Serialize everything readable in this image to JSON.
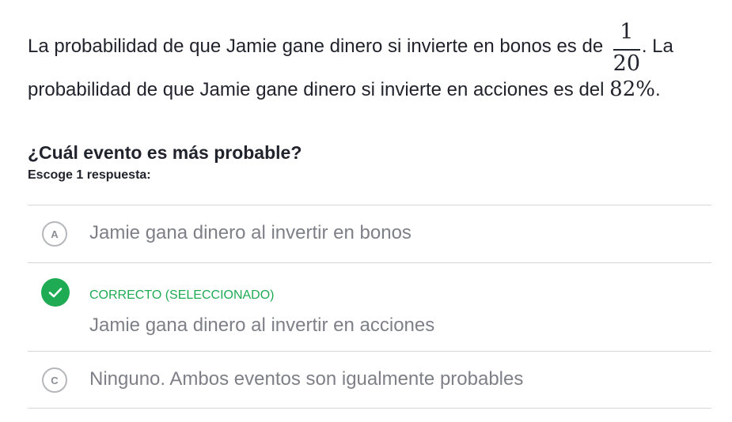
{
  "question": {
    "line1_text": "La probabilidad de que Jamie gane dinero si invierte en bonos es de",
    "fraction_numerator": "1",
    "fraction_denominator": "20",
    "line1_tail": ". La",
    "line2_text": "probabilidad de que Jamie gane dinero si invierte en acciones es del",
    "line2_math": "82%",
    "line2_tail": "."
  },
  "prompt": "¿Cuál evento es más probable?",
  "instructions": "Escoge 1 respuesta:",
  "choices": [
    {
      "letter": "A",
      "text": "Jamie gana dinero al invertir en bonos",
      "selected": false
    },
    {
      "letter": "B",
      "text": "Jamie gana dinero al invertir en acciones",
      "selected": true,
      "status": "CORRECTO (SELECCIONADO)"
    },
    {
      "letter": "C",
      "text": "Ninguno. Ambos eventos son igualmente probables",
      "selected": false
    }
  ],
  "colors": {
    "correct": "#1fab54",
    "muted_text": "#7d8087",
    "divider": "#d6d8da"
  }
}
